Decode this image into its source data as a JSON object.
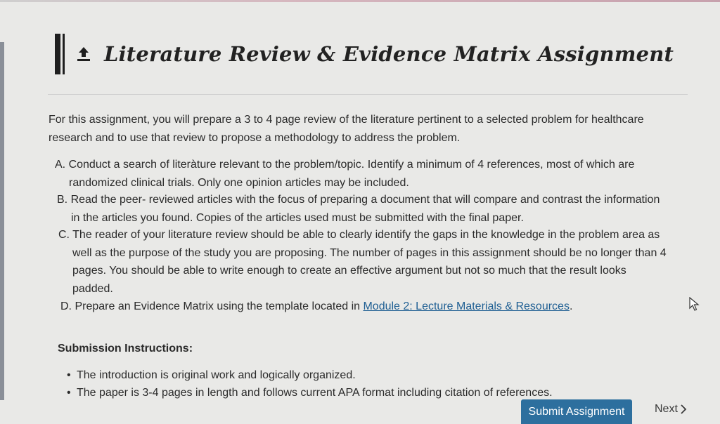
{
  "page": {
    "title": "Literature Review & Evidence Matrix Assignment",
    "title_icon": "upload-icon"
  },
  "intro": {
    "line1": "For this assignment, you will prepare a 3 to 4 page review of the literature pertinent to a selected problem for healthcare",
    "line2": "research and to use that review to propose a methodology to address the problem."
  },
  "items": [
    {
      "letter": "A.",
      "lines": [
        "Conduct a search of literàture relevant to the problem/topic. Identify a minimum of 4 references, most of which are",
        "randomized clinical trials. Only one opinion articles may be included."
      ]
    },
    {
      "letter": "B.",
      "lines": [
        "Read the peer- reviewed articles with the focus of preparing a document that will compare and contrast the information",
        "in the articles you found. Copies of the articles used must be submitted with the final paper."
      ]
    },
    {
      "letter": "C.",
      "lines": [
        "The reader of your literature review should be able to clearly identify the gaps in the knowledge in the problem area as",
        "well as the purpose of the study you are proposing. The number of pages in this assignment should be no longer than 4",
        "pages. You should be able to write enough to create an effective argument but not so much that the result looks",
        "padded."
      ]
    },
    {
      "letter": "D.",
      "text_before": "Prepare an Evidence Matrix using the template located in ",
      "link": "Module 2: Lecture Materials & Resources",
      "text_after": "."
    }
  ],
  "submission": {
    "heading": "Submission Instructions:",
    "bullets": [
      "The introduction is original work and logically organized.",
      "The paper is 3-4 pages in length and follows current APA format including citation of references."
    ]
  },
  "footer": {
    "submit_label": "Submit Assignment",
    "next_label": "Next",
    "next_icon": "chevron-right-icon"
  },
  "colors": {
    "background": "#e9e9e7",
    "button": "#2d6f9e",
    "link": "#1f5f93"
  }
}
